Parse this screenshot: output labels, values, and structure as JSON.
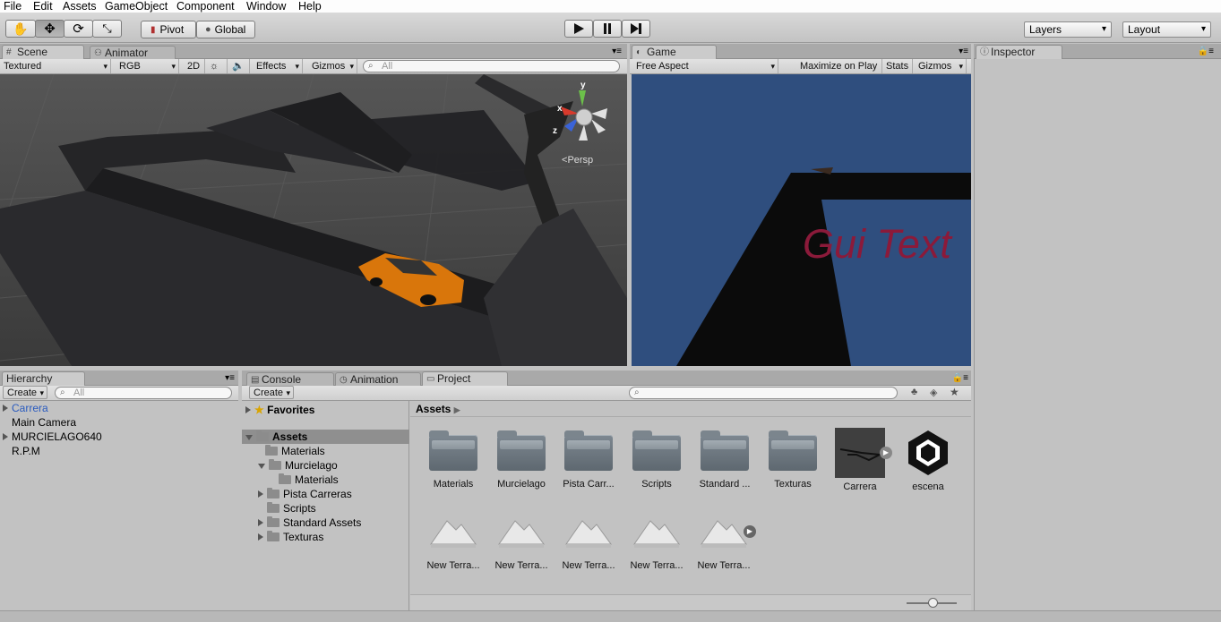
{
  "menu": [
    "File",
    "Edit",
    "Assets",
    "GameObject",
    "Component",
    "Window",
    "Help"
  ],
  "toolbar": {
    "pivot_label": "Pivot",
    "global_label": "Global",
    "layers_label": "Layers",
    "layout_label": "Layout"
  },
  "scene": {
    "tab_scene": "Scene",
    "tab_animator": "Animator",
    "shading": "Textured",
    "render": "RGB",
    "mode2d": "2D",
    "effects": "Effects",
    "gizmos": "Gizmos",
    "search_placeholder": "All",
    "persp": "Persp",
    "axis_x": "x",
    "axis_y": "y",
    "axis_z": "z"
  },
  "game": {
    "tab": "Game",
    "aspect": "Free Aspect",
    "maximize": "Maximize on Play",
    "stats": "Stats",
    "gizmos": "Gizmos",
    "gui_text": "Gui Text"
  },
  "inspector": {
    "tab": "Inspector"
  },
  "hierarchy": {
    "tab": "Hierarchy",
    "create": "Create",
    "search_placeholder": "All",
    "items": [
      "Carrera",
      "Main Camera",
      "MURCIELAGO640",
      "R.P.M"
    ]
  },
  "bottom_tabs": {
    "console": "Console",
    "animation": "Animation",
    "project": "Project"
  },
  "project": {
    "create": "Create",
    "favorites": "Favorites",
    "assets_root": "Assets",
    "tree": [
      "Materials",
      "Murcielago",
      "Materials",
      "Pista Carreras",
      "Scripts",
      "Standard Assets",
      "Texturas"
    ],
    "breadcrumb": "Assets",
    "assets_row1": [
      "Materials",
      "Murcielago",
      "Pista Carr...",
      "Scripts",
      "Standard ...",
      "Texturas",
      "Carrera",
      "escena"
    ],
    "assets_row2": [
      "New Terra...",
      "New Terra...",
      "New Terra...",
      "New Terra...",
      "New Terra..."
    ]
  },
  "colors": {
    "accent_selected": "#3e6fb8",
    "gui_text": "#8b1a3a",
    "game_bg": "#2f4e7e"
  }
}
